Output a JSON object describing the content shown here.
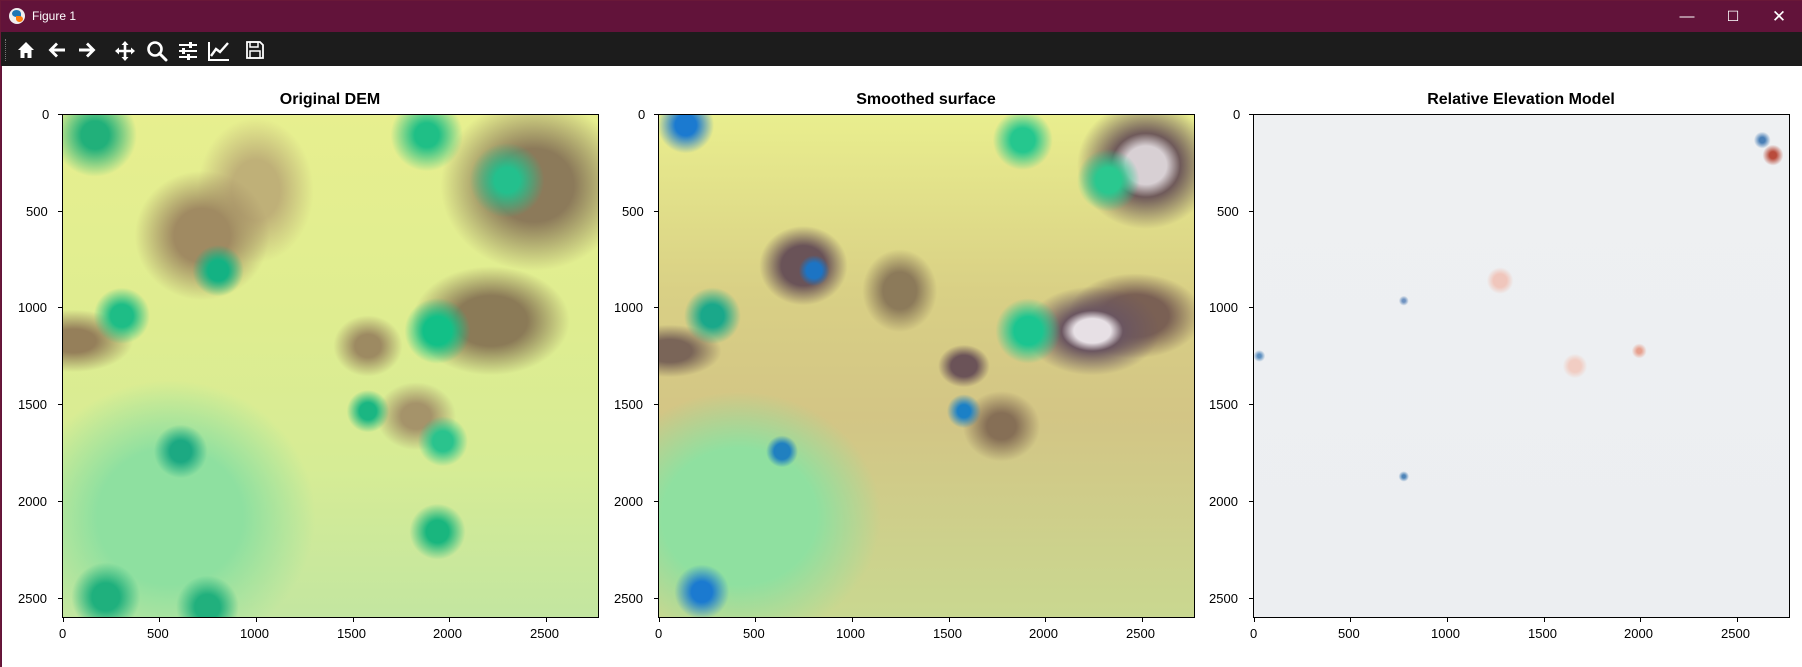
{
  "window": {
    "title": "Figure 1",
    "controls": {
      "minimize": "—",
      "maximize": "☐",
      "close": "✕"
    }
  },
  "toolbar": {
    "buttons": [
      {
        "name": "home-icon"
      },
      {
        "name": "back-icon"
      },
      {
        "name": "forward-icon"
      },
      {
        "name": "pan-icon"
      },
      {
        "name": "zoom-icon"
      },
      {
        "name": "configure-subplots-icon"
      },
      {
        "name": "edit-axes-icon"
      },
      {
        "name": "save-icon"
      }
    ]
  },
  "figure": {
    "panels": [
      {
        "title": "Original DEM",
        "colormap": "terrain"
      },
      {
        "title": "Smoothed surface",
        "colormap": "terrain"
      },
      {
        "title": "Relative Elevation Model",
        "colormap": "RdBu"
      }
    ],
    "x_ticks": [
      "0",
      "500",
      "1000",
      "1500",
      "2000",
      "2500"
    ],
    "y_ticks": [
      "0",
      "500",
      "1000",
      "1500",
      "2000",
      "2500"
    ]
  },
  "chart_data": [
    {
      "type": "heatmap",
      "title": "Original DEM",
      "xlim": [
        0,
        2770
      ],
      "ylim": [
        2600,
        0
      ],
      "xticks": [
        0,
        500,
        1000,
        1500,
        2000,
        2500
      ],
      "yticks": [
        0,
        500,
        1000,
        1500,
        2000,
        2500
      ]
    },
    {
      "type": "heatmap",
      "title": "Smoothed surface",
      "xlim": [
        0,
        2770
      ],
      "ylim": [
        2600,
        0
      ],
      "xticks": [
        0,
        500,
        1000,
        1500,
        2000,
        2500
      ],
      "yticks": [
        0,
        500,
        1000,
        1500,
        2000,
        2500
      ]
    },
    {
      "type": "heatmap",
      "title": "Relative Elevation Model",
      "xlim": [
        0,
        2770
      ],
      "ylim": [
        2600,
        0
      ],
      "xticks": [
        0,
        500,
        1000,
        1500,
        2000,
        2500
      ],
      "yticks": [
        0,
        500,
        1000,
        1500,
        2000,
        2500
      ]
    }
  ]
}
